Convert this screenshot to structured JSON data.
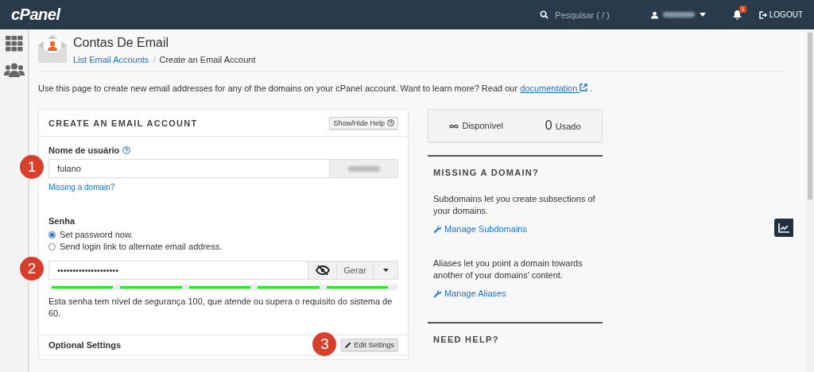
{
  "navbar": {
    "logo": "cPanel",
    "search_placeholder": "Pesquisar ( / )",
    "notifications": "1",
    "logout": "LOGOUT"
  },
  "page": {
    "title": "Contas De Email",
    "breadcrumb_separator": "/",
    "breadcrumb": [
      {
        "label": "List Email Accounts",
        "kind": "link"
      },
      {
        "label": "Create an Email Account",
        "kind": "current"
      }
    ],
    "description": "Use this page to create new email addresses for any of the domains on your cPanel account. Want to learn more? Read our",
    "description_link": "documentation",
    "description_end": "."
  },
  "form": {
    "title": "CREATE AN EMAIL ACCOUNT",
    "help_button": "Show/Hide Help",
    "username_label": "Nome de usuário",
    "username_value": "fulano",
    "missing_domain_link": "Missing a domain?",
    "password_label": "Senha",
    "password_options": [
      {
        "label": "Set password now.",
        "selected": true
      },
      {
        "label": "Send login link to alternate email address.",
        "selected": false
      }
    ],
    "password_value": "••••••••••••••••••••",
    "generate_button": "Gerar",
    "strength": {
      "level": 1
    },
    "strength_text": "Esta senha tem nível de segurança 100, que atende ou supera o requisito do sistema de 60.",
    "optional_title": "Optional Settings",
    "edit_button": "Edit Settings"
  },
  "callouts": [
    "1",
    "2",
    "3"
  ],
  "stats": {
    "available_label": "Disponível",
    "used_value": "0",
    "used_label": "Usado"
  },
  "sidebar_panels": [
    {
      "title": "MISSING A DOMAIN?",
      "items": [
        {
          "text": "Subdomains let you create subsections of your domains.",
          "link": "Manage Subdomains"
        },
        {
          "text": "Aliases let you point a domain towards another of your domains' content.",
          "link": "Manage Aliases"
        }
      ]
    },
    {
      "title": "NEED HELP?"
    }
  ]
}
